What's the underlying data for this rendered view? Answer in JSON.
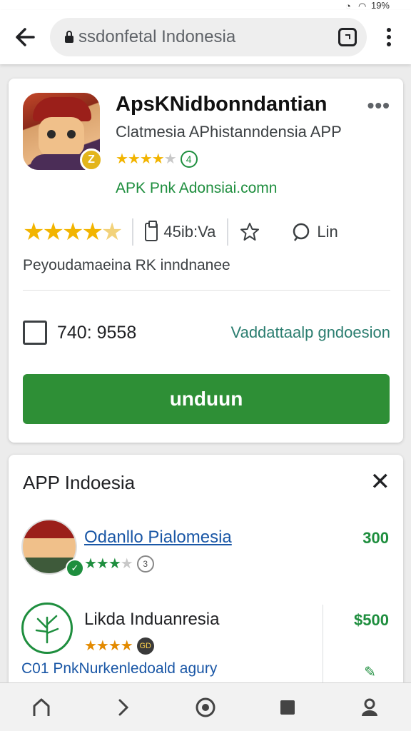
{
  "status_bar": {
    "text": "19%"
  },
  "browser": {
    "url": "ssdonfetal Indonesia"
  },
  "app_card": {
    "title": "ApsKNidbonndantian",
    "subtitle": "Clatmesia APhistanndensia APP",
    "rating_count_badge": "4",
    "developer_link": "APK Pnk Adonsiai.comn",
    "stats": {
      "size": "45ib:Va",
      "wishlist_label": "",
      "reviews": "Lin"
    },
    "description": "Peyoudamaeina RK inndnanee",
    "checkbox_value": "740: 9558",
    "verify_link": "Vaddattaalp gndoesion",
    "download_label": "unduun"
  },
  "related_card": {
    "title": "APP Indoesia",
    "items": [
      {
        "name": "Odanllo Pialomesia",
        "price": "300",
        "badge": "3"
      },
      {
        "name": "Likda Induanresia",
        "price": "$500",
        "badge": "GD"
      }
    ],
    "partial_item": "C01 PnkNurkenledoald agury"
  },
  "colors": {
    "accent_green": "#2e8f36",
    "star_yellow": "#f2b400",
    "link_blue": "#1a57a6"
  }
}
